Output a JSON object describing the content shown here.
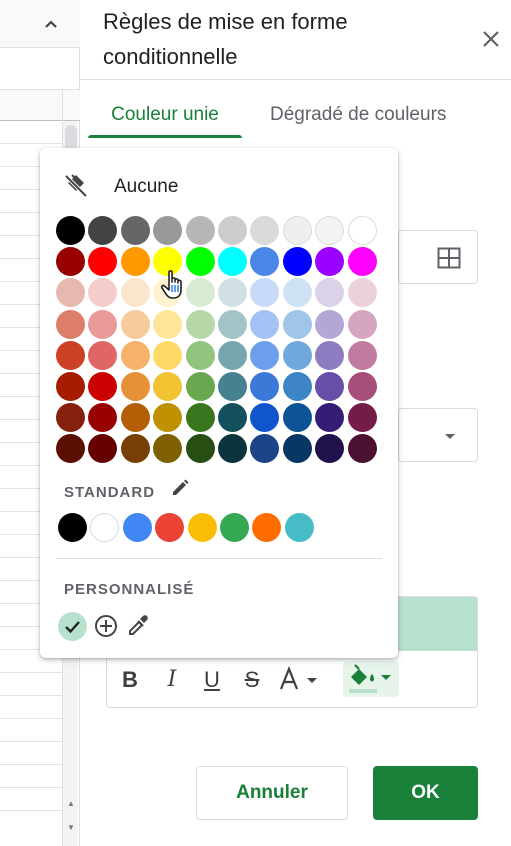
{
  "panel": {
    "title": "Règles de mise en forme conditionnelle",
    "tabs": [
      {
        "label": "Couleur unie",
        "active": true
      },
      {
        "label": "Dégradé de couleurs",
        "active": false
      }
    ],
    "cancel_label": "Annuler",
    "ok_label": "OK",
    "preview_fill_color": "#b7e1cd",
    "accent_color": "#188038"
  },
  "color_picker": {
    "none_label": "Aucune",
    "palette_rows": [
      [
        "#000000",
        "#434343",
        "#666666",
        "#999999",
        "#b7b7b7",
        "#cccccc",
        "#d9d9d9",
        "#efefef",
        "#f3f3f3",
        "#ffffff"
      ],
      [
        "#980000",
        "#ff0000",
        "#ff9900",
        "#ffff00",
        "#00ff00",
        "#00ffff",
        "#4a86e8",
        "#0000ff",
        "#9900ff",
        "#ff00ff"
      ],
      [
        "#e6b8af",
        "#f4cccc",
        "#fce5cd",
        "#fff2cc",
        "#d9ead3",
        "#d0e0e3",
        "#c9daf8",
        "#cfe2f3",
        "#d9d2e9",
        "#ead1dc"
      ],
      [
        "#dd7e6b",
        "#ea9999",
        "#f9cb9c",
        "#ffe599",
        "#b6d7a8",
        "#a2c4c9",
        "#a4c2f4",
        "#9fc5e8",
        "#b4a7d6",
        "#d5a6bd"
      ],
      [
        "#cc4125",
        "#e06666",
        "#f6b26b",
        "#ffd966",
        "#93c47d",
        "#76a5af",
        "#6d9eeb",
        "#6fa8dc",
        "#8e7cc3",
        "#c27ba0"
      ],
      [
        "#a61c00",
        "#cc0000",
        "#e69138",
        "#f1c232",
        "#6aa84f",
        "#45818e",
        "#3c78d8",
        "#3d85c6",
        "#674ea7",
        "#a64d79"
      ],
      [
        "#85200c",
        "#990000",
        "#b45f06",
        "#bf9000",
        "#38761d",
        "#134f5c",
        "#1155cc",
        "#0b5394",
        "#351c75",
        "#741b47"
      ],
      [
        "#5b0f00",
        "#660000",
        "#783f04",
        "#7f6000",
        "#274e13",
        "#0c343d",
        "#1c4587",
        "#073763",
        "#20124d",
        "#4c1130"
      ]
    ],
    "standard_label": "STANDARD",
    "standard_colors": [
      "#000000",
      "#ffffff",
      "#4285f4",
      "#ea4335",
      "#fbbc04",
      "#34a853",
      "#ff6d01",
      "#46bdc6"
    ],
    "custom_label": "PERSONNALISÉ",
    "custom_colors": [
      "#b7e1cd"
    ],
    "selected_color": "#b7e1cd"
  }
}
